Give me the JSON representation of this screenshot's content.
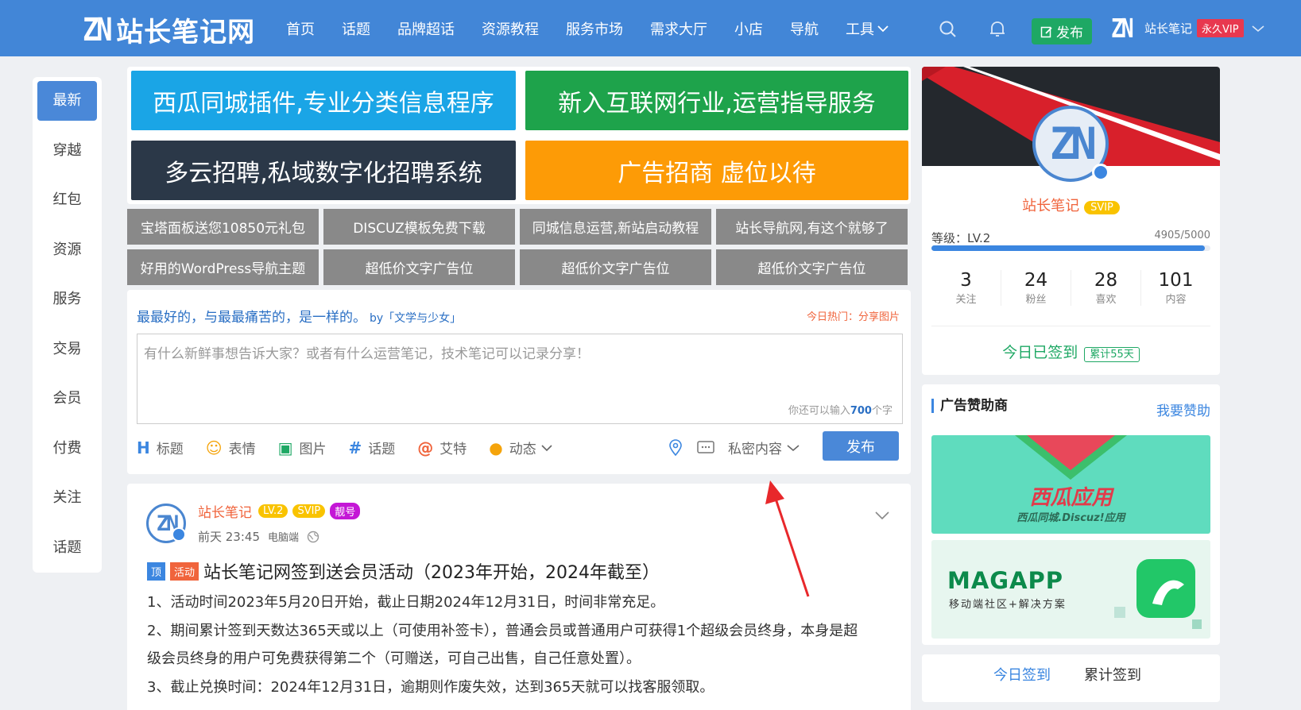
{
  "header": {
    "logo_mark": "ZN",
    "logo_text": "站长笔记网",
    "nav": [
      "首页",
      "话题",
      "品牌超话",
      "资源教程",
      "服务市场",
      "需求大厅",
      "小店",
      "导航",
      "工具"
    ],
    "publish": "发布",
    "user_mark": "ZN",
    "username": "站长笔记",
    "vip": "永久VIP"
  },
  "sidebar": [
    "最新",
    "穿越",
    "红包",
    "资源",
    "服务",
    "交易",
    "会员",
    "付费",
    "关注",
    "话题"
  ],
  "big_ads": [
    {
      "text": "西瓜同城插件,专业分类信息程序",
      "color": "#1aa5e6"
    },
    {
      "text": "新入互联网行业,运营指导服务",
      "color": "#1ea34b"
    },
    {
      "text": "多云招聘,私域数字化招聘系统",
      "color": "#2b3848"
    },
    {
      "text": "广告招商 虚位以待",
      "color": "#fd9b06"
    }
  ],
  "small_ads": [
    "宝塔面板送您10850元礼包",
    "DISCUZ模板免费下载",
    "同城信息运营,新站启动教程",
    "站长导航网,有这个就够了",
    "好用的WordPress导航主题",
    "超低价文字广告位",
    "超低价文字广告位",
    "超低价文字广告位"
  ],
  "composer": {
    "quote": "最最好的，与最最痛苦的，是一样的。",
    "quote_by": "by「文学与少女」",
    "hot_prefix": "今日热门：",
    "hot_topic": "分享图片",
    "placeholder": "有什么新鲜事想告诉大家？或者有什么运营笔记，技术笔记可以记录分享！",
    "remain_pre": "你还可以输入",
    "remain_num": "700",
    "remain_post": "个字",
    "tools": [
      {
        "icon": "H",
        "label": "标题"
      },
      {
        "icon": "☺",
        "label": "表情"
      },
      {
        "icon": "▣",
        "label": "图片"
      },
      {
        "icon": "#",
        "label": "话题"
      },
      {
        "icon": "@",
        "label": "艾特"
      },
      {
        "icon": "●",
        "label": "动态"
      }
    ],
    "privacy": "私密内容",
    "send": "发布"
  },
  "post": {
    "avatar_mark": "ZN",
    "author": "站长笔记",
    "badges": [
      {
        "text": "LV.2",
        "color": "#f9c300"
      },
      {
        "text": "SVIP",
        "color": "#f9c300"
      },
      {
        "text": "靓号",
        "color": "#c417d6"
      }
    ],
    "time": "前天 23:45",
    "device": "电脑端",
    "tag_top": "顶",
    "tag_activity": "活动",
    "title": "站长笔记网签到送会员活动（2023年开始，2024年截至）",
    "lines": [
      "1、活动时间2023年5月20日开始，截止日期2024年12月31日，时间非常充足。",
      "2、期间累计签到天数达365天或以上（可使用补签卡），普通会员或普通用户可获得1个超级会员终身，本身是超级会员终身的用户可免费获得第二个（可赠送，可自己出售，自己任意处置）。",
      "3、截止兑换时间：2024年12月31日，逾期则作废失效，达到365天就可以找客服领取。"
    ]
  },
  "profile": {
    "avatar_mark": "ZN",
    "name": "站长笔记",
    "svip": "SVIP",
    "level": "等级：LV.2",
    "exp": "4905/5000",
    "exp_fraction": 0.981,
    "stats": [
      {
        "num": "3",
        "label": "关注"
      },
      {
        "num": "24",
        "label": "粉丝"
      },
      {
        "num": "28",
        "label": "喜欢"
      },
      {
        "num": "101",
        "label": "内容"
      }
    ],
    "signed": "今日已签到",
    "days": "累计55天"
  },
  "sponsors": {
    "title": "广告赞助商",
    "link": "我要赞助",
    "b1_title": "西瓜应用",
    "b1_sub": "西瓜同城.Discuz!应用",
    "b2_title": "MAGAPP",
    "b2_sub": "移动端社区+解决方案"
  },
  "signin_tabs": [
    "今日签到",
    "累计签到"
  ],
  "colors": {
    "brand": "#4286d7",
    "accent": "#3b86e0",
    "green": "#1ea864",
    "hot": "#f0643c"
  }
}
